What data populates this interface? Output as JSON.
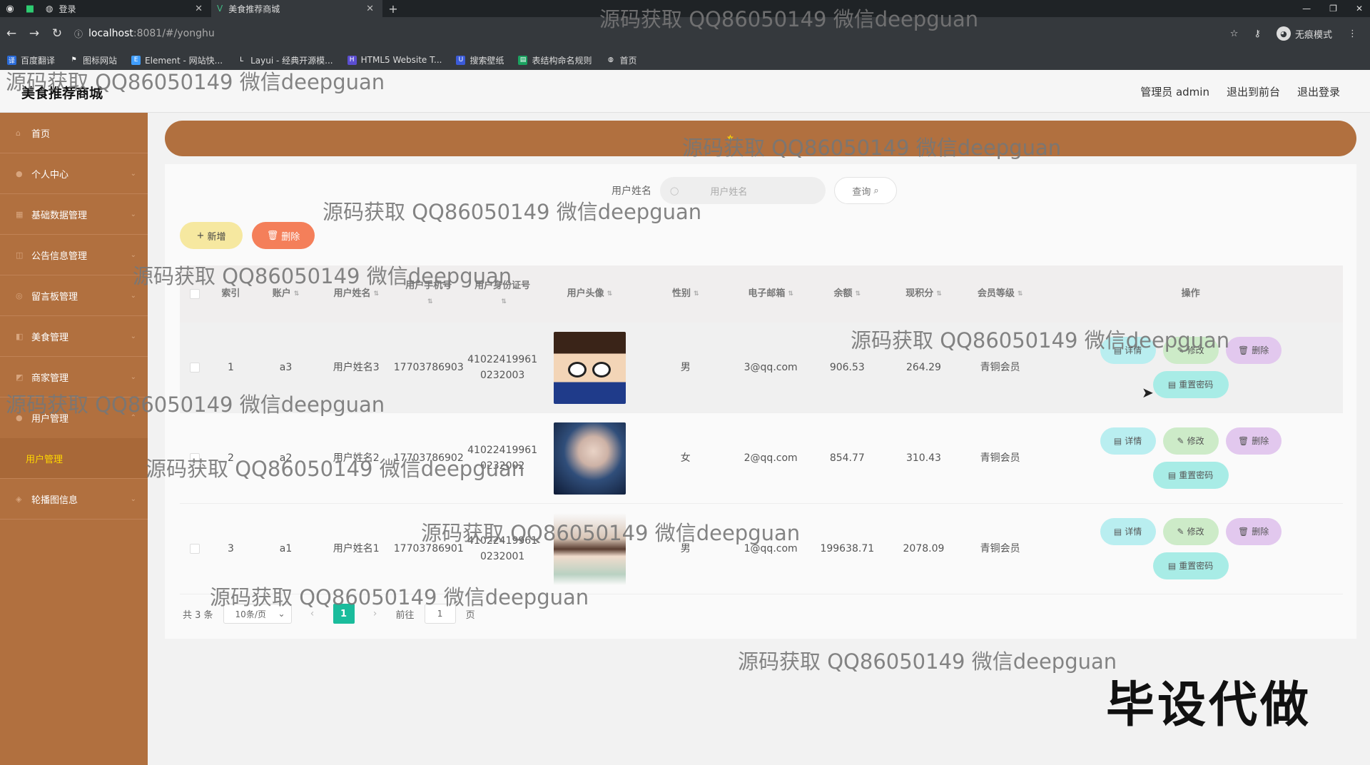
{
  "browser": {
    "tabs": [
      {
        "label": "登录",
        "icon": "globe-icon"
      },
      {
        "label": "美食推荐商城",
        "icon": "vue-icon"
      }
    ],
    "url_host": "localhost",
    "url_path": ":8081/#/yonghu",
    "incognito_label": "无痕模式",
    "bookmarks": [
      "百度翻译",
      "图标网站",
      "Element - 网站快...",
      "Layui - 经典开源模...",
      "HTML5 Website T...",
      "搜索壁纸",
      "表结构命名规则",
      "首页"
    ]
  },
  "header": {
    "title": "美食推荐商城",
    "admin": "管理员 admin",
    "to_front": "退出到前台",
    "logout": "退出登录"
  },
  "sidebar": {
    "items": [
      {
        "label": "首页"
      },
      {
        "label": "个人中心"
      },
      {
        "label": "基础数据管理"
      },
      {
        "label": "公告信息管理"
      },
      {
        "label": "留言板管理"
      },
      {
        "label": "美食管理"
      },
      {
        "label": "商家管理"
      },
      {
        "label": "用户管理"
      },
      {
        "label": "轮播图信息"
      }
    ],
    "sub_item": "用户管理",
    "colors": {
      "bg": "#b1703f",
      "active": "#ffd700"
    }
  },
  "search": {
    "label": "用户姓名",
    "placeholder": "用户姓名",
    "button": "查询"
  },
  "actions": {
    "add": "新增",
    "delete": "删除"
  },
  "table": {
    "columns": [
      "索引",
      "账户",
      "用户姓名",
      "用户手机号",
      "用户身份证号",
      "用户头像",
      "性别",
      "电子邮箱",
      "余额",
      "现积分",
      "会员等级",
      "操作"
    ],
    "rows": [
      {
        "index": "1",
        "account": "a3",
        "name": "用户姓名3",
        "phone": "17703786903",
        "id1": "41022419961",
        "id2": "0232003",
        "gender": "男",
        "email": "3@qq.com",
        "balance": "906.53",
        "points": "264.29",
        "level": "青铜会员"
      },
      {
        "index": "2",
        "account": "a2",
        "name": "用户姓名2",
        "phone": "17703786902",
        "id1": "41022419961",
        "id2": "0232002",
        "gender": "女",
        "email": "2@qq.com",
        "balance": "854.77",
        "points": "310.43",
        "level": "青铜会员"
      },
      {
        "index": "3",
        "account": "a1",
        "name": "用户姓名1",
        "phone": "17703786901",
        "id1": "41022419961",
        "id2": "0232001",
        "gender": "男",
        "email": "1@qq.com",
        "balance": "199638.71",
        "points": "2078.09",
        "level": "青铜会员"
      }
    ],
    "ops": {
      "detail": "详情",
      "edit": "修改",
      "remove": "删除",
      "reset": "重置密码"
    }
  },
  "pager": {
    "total": "共 3 条",
    "page_size": "10条/页",
    "current": "1",
    "goto_prefix": "前往",
    "goto_value": "1",
    "goto_suffix": "页"
  },
  "watermark": "源码获取 QQ86050149 微信deepguan",
  "stamp": "毕设代做"
}
